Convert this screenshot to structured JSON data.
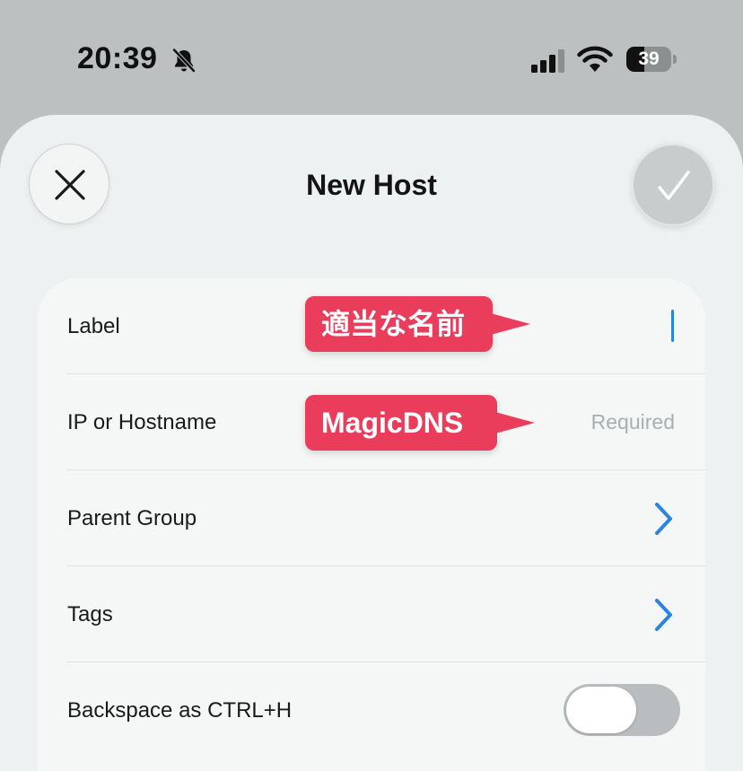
{
  "status_bar": {
    "time": "20:39",
    "battery_level": "39",
    "icons": [
      "bell-slash-icon",
      "cellular-signal-icon",
      "wifi-icon",
      "battery-icon"
    ]
  },
  "sheet": {
    "title": "New Host",
    "close_icon": "close-icon",
    "confirm_icon": "checkmark-icon"
  },
  "form": {
    "rows": [
      {
        "label": "Label",
        "value": "",
        "control": "text-input-with-cursor"
      },
      {
        "label": "IP or Hostname",
        "placeholder": "Required",
        "control": "text-input"
      },
      {
        "label": "Parent Group",
        "control": "chevron-right-icon"
      },
      {
        "label": "Tags",
        "control": "chevron-right-icon"
      },
      {
        "label": "Backspace as CTRL+H",
        "control": "toggle",
        "toggle_on": false
      }
    ]
  },
  "annotations": [
    {
      "text": "適当な名前",
      "points_to": "Label"
    },
    {
      "text": "MagicDNS",
      "points_to": "IP or Hostname"
    }
  ],
  "colors": {
    "accent": "#2a84e0",
    "callout": "#ea3c5b",
    "sheet_background": "#eef1f1",
    "backdrop": "#bcc0c0"
  }
}
